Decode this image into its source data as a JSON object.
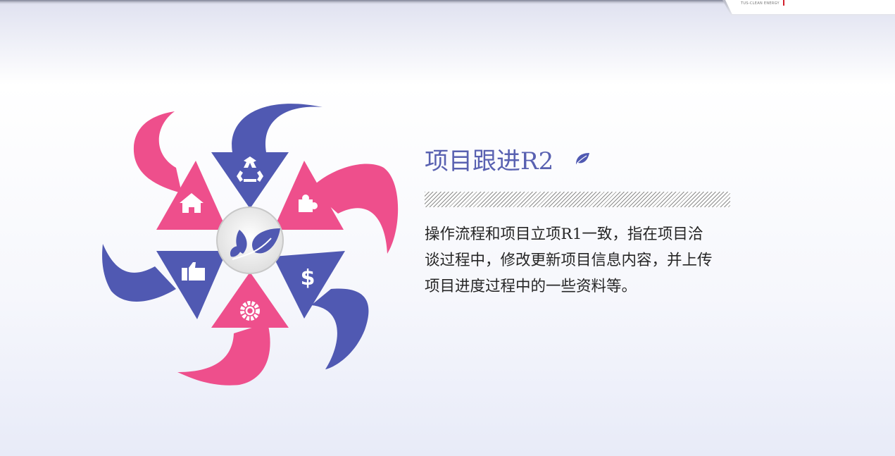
{
  "header": {
    "logo_caption": "TUS-CLEAN ENERGY"
  },
  "slide": {
    "title": "项目跟进R2",
    "body": "操作流程和项目立项R1一致，指在项目洽谈过程中，修改更新项目信息内容，并上传项目进度过程中的一些资料等。"
  },
  "graphic": {
    "colors": {
      "pink": "#ee4f8c",
      "blue": "#5059b2",
      "center_bg": "#ececec"
    },
    "icons": [
      "recycle-icon",
      "puzzle-icon",
      "dollar-icon",
      "gear-icon",
      "thumbs-up-icon",
      "home-icon",
      "leaf-icon"
    ]
  }
}
